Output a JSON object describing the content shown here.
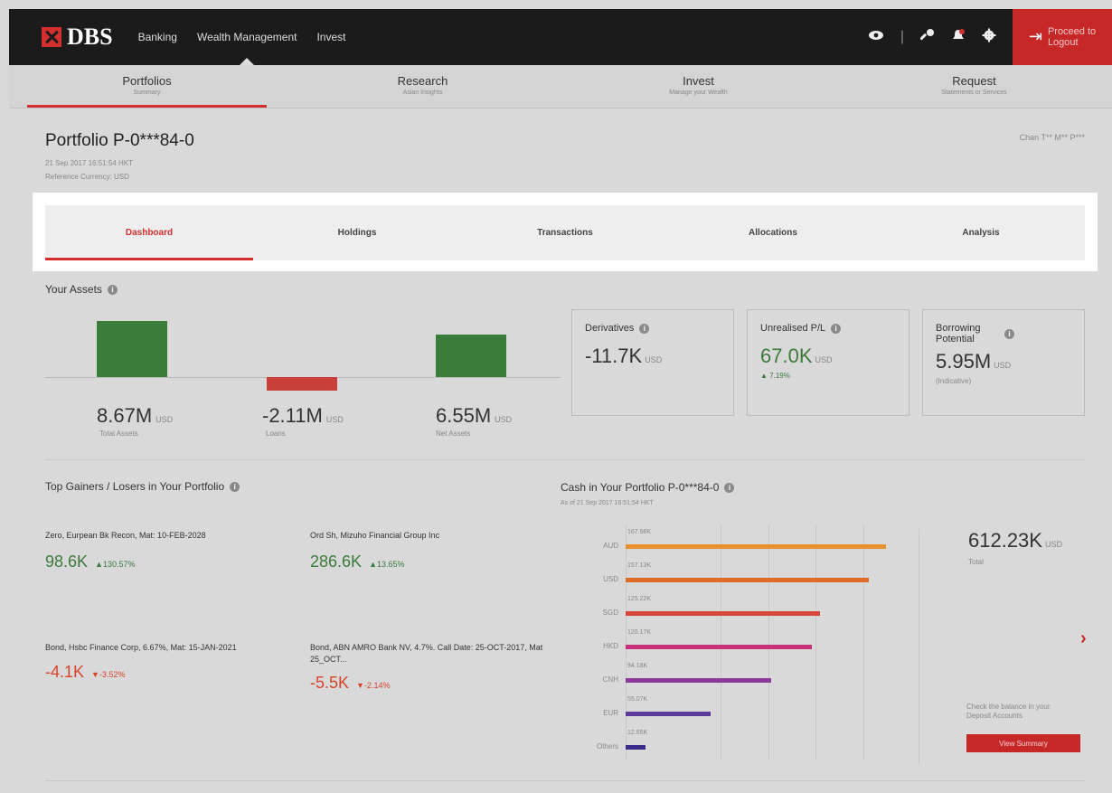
{
  "brand": {
    "name": "DBS"
  },
  "top_nav": [
    "Banking",
    "Wealth Management",
    "Invest"
  ],
  "top_icons": [
    "eye-icon",
    "key-icon",
    "bell-icon",
    "gear-icon"
  ],
  "logout": {
    "line1": "Proceed to",
    "line2": "Logout"
  },
  "sub_nav": [
    {
      "title": "Portfolios",
      "subtitle": "Summary"
    },
    {
      "title": "Research",
      "subtitle": "Asian Insights"
    },
    {
      "title": "Invest",
      "subtitle": "Manage your Wealth"
    },
    {
      "title": "Request",
      "subtitle": "Statements or Services"
    }
  ],
  "portfolio": {
    "title": "Portfolio P-0***84-0",
    "timestamp": "21 Sep 2017 16:51:54 HKT",
    "currency": "Reference Currency: USD",
    "owner": "Chan T** M** P***"
  },
  "tabs": [
    "Dashboard",
    "Holdings",
    "Transactions",
    "Allocations",
    "Analysis"
  ],
  "assets": {
    "title": "Your Assets",
    "unit": "USD",
    "items": [
      {
        "value": "8.67M",
        "label": "Total Assets",
        "amount": 8.67
      },
      {
        "value": "-2.11M",
        "label": "Loans",
        "amount": -2.11
      },
      {
        "value": "6.55M",
        "label": "Net Assets",
        "amount": 6.55
      }
    ]
  },
  "cards": {
    "derivatives": {
      "title": "Derivatives",
      "value": "-11.7K",
      "unit": "USD"
    },
    "unrealised": {
      "title": "Unrealised P/L",
      "value": "67.0K",
      "unit": "USD",
      "change": "▲ 7.19%"
    },
    "borrowing": {
      "title": "Borrowing Potential",
      "value": "5.95M",
      "unit": "USD",
      "note": "(Indicative)"
    }
  },
  "gainers": {
    "title": "Top Gainers / Losers in Your Portfolio",
    "items": [
      {
        "name": "Zero, Eurpean Bk Recon, Mat: 10-FEB-2028",
        "value": "98.6K",
        "pct": "▲130.57%"
      },
      {
        "name": "Ord Sh, Mizuho Financial Group Inc",
        "value": "286.6K",
        "pct": "▲13.65%"
      },
      {
        "name": "Bond, Hsbc Finance Corp, 6.67%, Mat: 15-JAN-2021",
        "value": "-4.1K",
        "pct": "▼-3.52%"
      },
      {
        "name": "Bond, ABN AMRO Bank NV, 4.7%. Call Date: 25-OCT-2017, Mat 25_OCT...",
        "value": "-5.5K",
        "pct": "▼-2.14%"
      }
    ]
  },
  "cash": {
    "title": "Cash in Your Portfolio P-0***84-0",
    "subtitle": "As of 21 Sep 2017 16:51:54 HKT",
    "total": "612.23K",
    "unit": "USD",
    "total_label": "Total",
    "check_text": "Check the balance in your Deposit Accounts",
    "button": "View Summary"
  },
  "chart_data": {
    "type": "bar",
    "orientation": "horizontal",
    "categories": [
      "AUD",
      "USD",
      "SGD",
      "HKD",
      "CNH",
      "EUR",
      "Others"
    ],
    "values": [
      167.98,
      157.13,
      125.22,
      120.17,
      94.18,
      55.07,
      12.65
    ],
    "labels": [
      "167.98K",
      "157.13K",
      "125.22K",
      "120.17K",
      "94.18K",
      "55.07K",
      "12.65K"
    ],
    "colors": [
      "#e8912d",
      "#e06a28",
      "#d8443a",
      "#c8307a",
      "#8a3a9a",
      "#5a3a9a",
      "#3a2e8a"
    ],
    "xlim": [
      0,
      175
    ]
  }
}
